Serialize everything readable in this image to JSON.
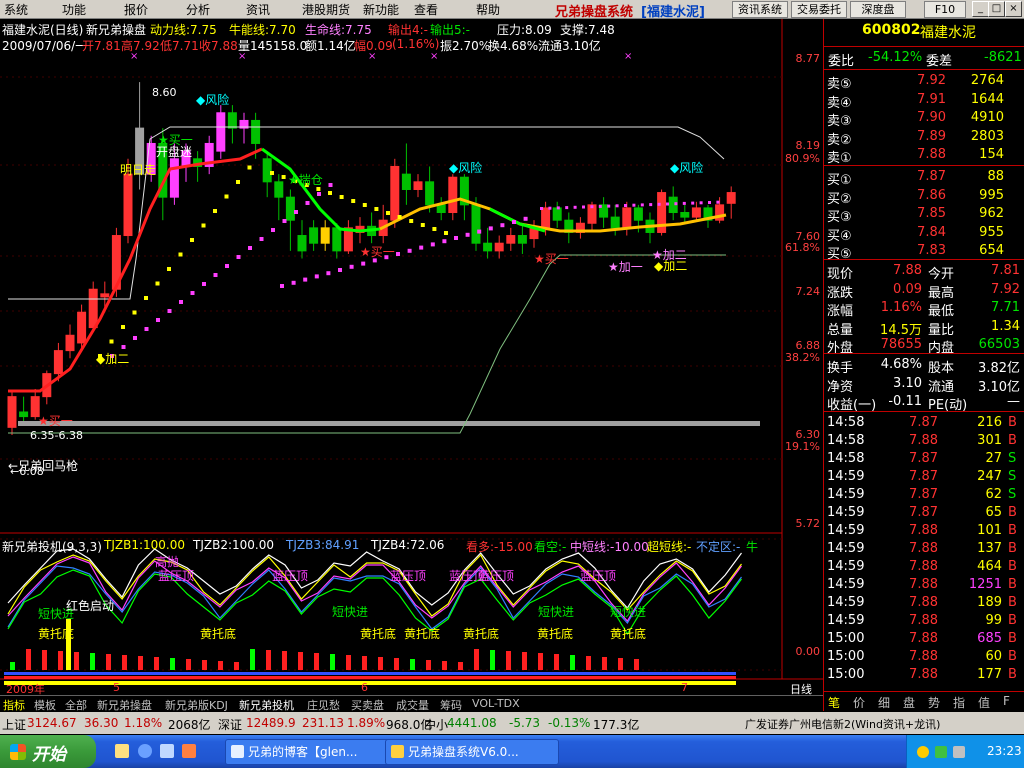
{
  "menu": {
    "items": [
      "系统",
      "功能",
      "报价",
      "分析",
      "资讯",
      "港股期货",
      "新功能",
      "查看",
      "帮助"
    ],
    "system_title": "兄弟操盘系统",
    "stock_title": "[福建水泥]",
    "buttons": [
      "资讯系统",
      "交易委托",
      "深度盘",
      "F10"
    ]
  },
  "chart": {
    "line1": {
      "name": "福建水泥(日线)",
      "indicator": "新兄弟操盘",
      "power": "动力线:7.75",
      "bull": "牛能线:7.70",
      "life": "生命线:7.75",
      "out4": "输出4:-",
      "out5": "输出5:-",
      "pressure": "压力:8.09",
      "support": "支撑:7.48"
    },
    "line2": {
      "date": "2009/07/06/一",
      "open": "开7.81",
      "high": "高7.92",
      "low": "低7.71",
      "close": "收7.88",
      "vol": "量145158.0",
      "amount": "额1.14亿",
      "range": "幅0.09",
      "change": "(1.16%)",
      "amp": "振2.70%",
      "turnover": "换4.68%",
      "float": "流通3.10亿"
    },
    "annotations": {
      "high_label": "8.60",
      "risk": "风险",
      "buy_one": "买一",
      "open_hammer": "开盘迷",
      "bright_day": "明日走",
      "stay": "揣仓",
      "add_two": "加二",
      "add_one": "加一",
      "buy": "买一",
      "low_range": "6.35-6.38",
      "brother_horse": "兄弟回马枪",
      "low_label": "6.08"
    },
    "price_axis": [
      "8.77",
      "8.19",
      "80.9%",
      "7.60",
      "61.8%",
      "7.24",
      "6.88",
      "38.2%",
      "6.30",
      "19.1%",
      "5.72"
    ],
    "indicator_header": {
      "name": "新兄弟投机(9,3,3)",
      "tj1": "TJZB1:100.00",
      "tj2": "TJZB2:100.00",
      "tj3": "TJZB3:84.91",
      "tj4": "TJZB4:72.06",
      "look_long": "看多:-15.00",
      "look_empty": "看空:-",
      "mid_short": "中短线:-10.00",
      "super_short": "超短线:-",
      "uncertain": "不定区:-",
      "cow": "牛"
    },
    "indicator_labels": {
      "high_throw": "高抛",
      "blue_press": "蓝压顶",
      "short_fast": "短快进",
      "red_start": "红色启动",
      "yellow_bottom": "黄托底"
    },
    "indicator_axis": "0.00",
    "time_axis": {
      "year": "2009年",
      "m5": "5",
      "m6": "6",
      "m7": "7",
      "period": "日线"
    }
  },
  "tabs": [
    "指标",
    "模板",
    "全部",
    "新兄弟操盘",
    "新兄弟版KDJ",
    "新兄弟投机",
    "庄见愁",
    "买卖盘",
    "成交量",
    "筹码",
    "VOL-TDX"
  ],
  "quote": {
    "code": "600802",
    "name": "福建水泥",
    "weibi_label": "委比",
    "weibi": "-54.12%",
    "weicha_label": "委差",
    "weicha": "-8621",
    "asks": [
      {
        "label": "卖⑤",
        "price": "7.92",
        "vol": "2764"
      },
      {
        "label": "卖④",
        "price": "7.91",
        "vol": "1644"
      },
      {
        "label": "卖③",
        "price": "7.90",
        "vol": "4910"
      },
      {
        "label": "卖②",
        "price": "7.89",
        "vol": "2803"
      },
      {
        "label": "卖①",
        "price": "7.88",
        "vol": "154"
      }
    ],
    "bids": [
      {
        "label": "买①",
        "price": "7.87",
        "vol": "88"
      },
      {
        "label": "买②",
        "price": "7.86",
        "vol": "995"
      },
      {
        "label": "买③",
        "price": "7.85",
        "vol": "962"
      },
      {
        "label": "买④",
        "price": "7.84",
        "vol": "955"
      },
      {
        "label": "买⑤",
        "price": "7.83",
        "vol": "654"
      }
    ],
    "stats": [
      {
        "l1": "现价",
        "v1": "7.88",
        "c1": "red",
        "l2": "今开",
        "v2": "7.81",
        "c2": "red"
      },
      {
        "l1": "涨跌",
        "v1": "0.09",
        "c1": "red",
        "l2": "最高",
        "v2": "7.92",
        "c2": "red"
      },
      {
        "l1": "涨幅",
        "v1": "1.16%",
        "c1": "red",
        "l2": "最低",
        "v2": "7.71",
        "c2": "green"
      },
      {
        "l1": "总量",
        "v1": "14.5万",
        "c1": "yellow",
        "l2": "量比",
        "v2": "1.34",
        "c2": "yellow"
      },
      {
        "l1": "外盘",
        "v1": "78655",
        "c1": "red",
        "l2": "内盘",
        "v2": "66503",
        "c2": "green"
      }
    ],
    "stats2": [
      {
        "l1": "换手",
        "v1": "4.68%",
        "l2": "股本",
        "v2": "3.82亿"
      },
      {
        "l1": "净资",
        "v1": "3.10",
        "l2": "流通",
        "v2": "3.10亿"
      },
      {
        "l1": "收益(一)",
        "v1": "-0.11",
        "l2": "PE(动)",
        "v2": "—"
      }
    ],
    "ticks": [
      {
        "t": "14:58",
        "p": "7.87",
        "v": "216",
        "d": "B",
        "pc": "red",
        "vc": "yellow"
      },
      {
        "t": "14:58",
        "p": "7.88",
        "v": "301",
        "d": "B",
        "pc": "red",
        "vc": "yellow"
      },
      {
        "t": "14:58",
        "p": "7.87",
        "v": "27",
        "d": "S",
        "pc": "red",
        "vc": "yellow"
      },
      {
        "t": "14:59",
        "p": "7.87",
        "v": "247",
        "d": "S",
        "pc": "red",
        "vc": "yellow"
      },
      {
        "t": "14:59",
        "p": "7.87",
        "v": "62",
        "d": "S",
        "pc": "red",
        "vc": "yellow"
      },
      {
        "t": "14:59",
        "p": "7.87",
        "v": "65",
        "d": "B",
        "pc": "red",
        "vc": "yellow"
      },
      {
        "t": "14:59",
        "p": "7.88",
        "v": "101",
        "d": "B",
        "pc": "red",
        "vc": "yellow"
      },
      {
        "t": "14:59",
        "p": "7.88",
        "v": "137",
        "d": "B",
        "pc": "red",
        "vc": "yellow"
      },
      {
        "t": "14:59",
        "p": "7.88",
        "v": "464",
        "d": "B",
        "pc": "red",
        "vc": "yellow"
      },
      {
        "t": "14:59",
        "p": "7.88",
        "v": "1251",
        "d": "B",
        "pc": "red",
        "vc": "magenta"
      },
      {
        "t": "14:59",
        "p": "7.88",
        "v": "189",
        "d": "B",
        "pc": "red",
        "vc": "yellow"
      },
      {
        "t": "14:59",
        "p": "7.88",
        "v": "99",
        "d": "B",
        "pc": "red",
        "vc": "yellow"
      },
      {
        "t": "15:00",
        "p": "7.88",
        "v": "685",
        "d": "B",
        "pc": "red",
        "vc": "magenta"
      },
      {
        "t": "15:00",
        "p": "7.88",
        "v": "60",
        "d": "B",
        "pc": "red",
        "vc": "yellow"
      },
      {
        "t": "15:00",
        "p": "7.88",
        "v": "177",
        "d": "B",
        "pc": "red",
        "vc": "yellow"
      }
    ],
    "bottom_tabs": [
      "笔",
      "价",
      "细",
      "盘",
      "势",
      "指",
      "值",
      "F"
    ]
  },
  "status": {
    "sh_label": "上证",
    "sh_value": "3124.67",
    "sh_change": "36.30",
    "sh_pct": "1.18%",
    "sh_amount": "2068亿",
    "sz_label": "深证",
    "sz_value": "12489.9",
    "sz_change": "231.13",
    "sz_pct": "1.89%",
    "sz_amount": "968.0亿",
    "zx_label": "中小",
    "zx_value": "4441.08",
    "zx_change": "-5.73",
    "zx_pct": "-0.13%",
    "zx_amount": "177.3亿",
    "broker": "广发证券广州电信新2(Wind资讯+龙讯)"
  },
  "taskbar": {
    "start": "开始",
    "tasks": [
      "兄弟的博客【glen...",
      "兄弟操盘系统V6.0..."
    ],
    "clock": "23:23"
  }
}
